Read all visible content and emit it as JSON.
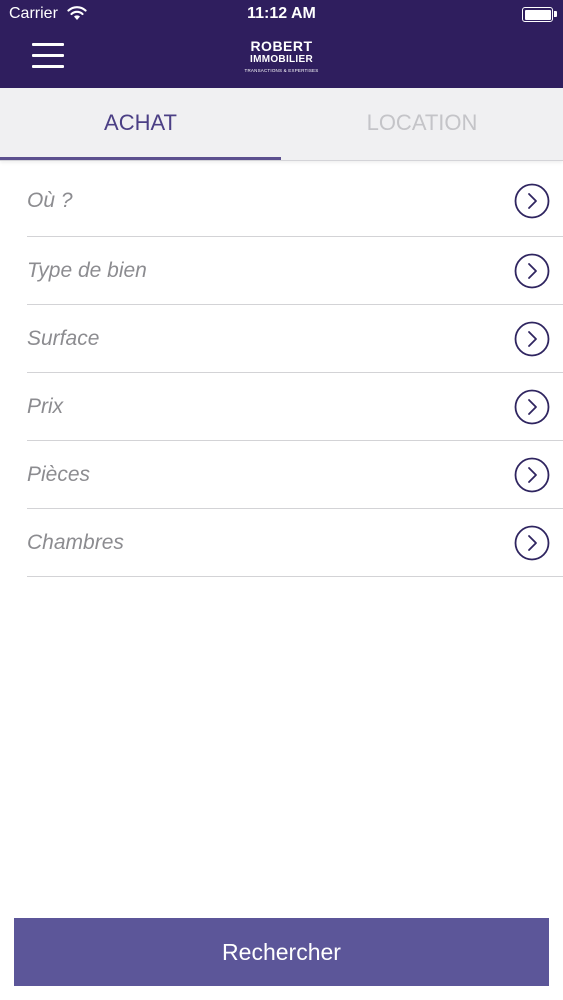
{
  "status_bar": {
    "carrier": "Carrier",
    "time": "11:12 AM"
  },
  "header": {
    "menu_icon": "hamburger-menu-icon",
    "logo": {
      "line1": "ROBERT",
      "line2": "IMMOBILIER",
      "line3": "TRANSACTIONS & EXPERTISES"
    }
  },
  "tabs": [
    {
      "label": "ACHAT",
      "active": true
    },
    {
      "label": "LOCATION",
      "active": false
    }
  ],
  "filters": [
    {
      "label": "Où ?"
    },
    {
      "label": "Type de bien"
    },
    {
      "label": "Surface"
    },
    {
      "label": "Prix"
    },
    {
      "label": "Pièces"
    },
    {
      "label": "Chambres"
    }
  ],
  "search_button": {
    "label": "Rechercher"
  },
  "colors": {
    "header_bg": "#2f1e5e",
    "tab_active": "#4b3f85",
    "tab_inactive": "#c4c4c8",
    "button_bg": "#5c5699",
    "chevron": "#2f2560"
  }
}
